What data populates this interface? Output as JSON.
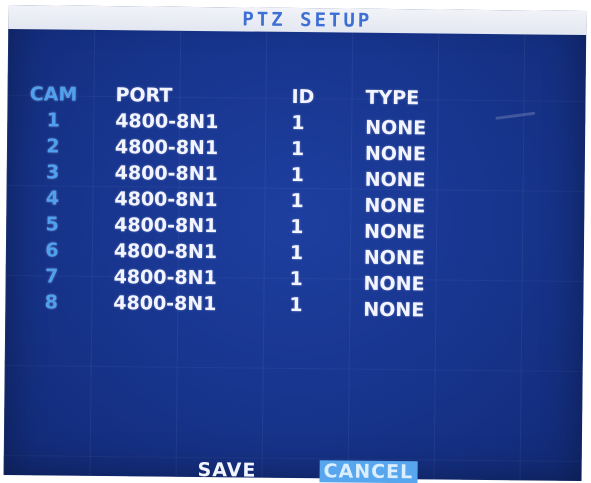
{
  "title": "PTZ SETUP",
  "columns": {
    "cam": "CAM",
    "port": "PORT",
    "id": "ID",
    "type": "TYPE"
  },
  "rows": [
    {
      "cam": "1",
      "port": "4800-8N1",
      "id": "1",
      "type": "NONE"
    },
    {
      "cam": "2",
      "port": "4800-8N1",
      "id": "1",
      "type": "NONE"
    },
    {
      "cam": "3",
      "port": "4800-8N1",
      "id": "1",
      "type": "NONE"
    },
    {
      "cam": "4",
      "port": "4800-8N1",
      "id": "1",
      "type": "NONE"
    },
    {
      "cam": "5",
      "port": "4800-8N1",
      "id": "1",
      "type": "NONE"
    },
    {
      "cam": "6",
      "port": "4800-8N1",
      "id": "1",
      "type": "NONE"
    },
    {
      "cam": "7",
      "port": "4800-8N1",
      "id": "1",
      "type": "NONE"
    },
    {
      "cam": "8",
      "port": "4800-8N1",
      "id": "1",
      "type": "NONE"
    }
  ],
  "footer": {
    "save_label": "SAVE",
    "cancel_label": "CANCEL"
  },
  "colors": {
    "background": "#17348c",
    "title_bar": "#e9ecf4",
    "title_text": "#3d6fd4",
    "cam_text": "#4fa0ee",
    "text": "#f2f4ff",
    "selected_highlight": "#57a6ee"
  }
}
